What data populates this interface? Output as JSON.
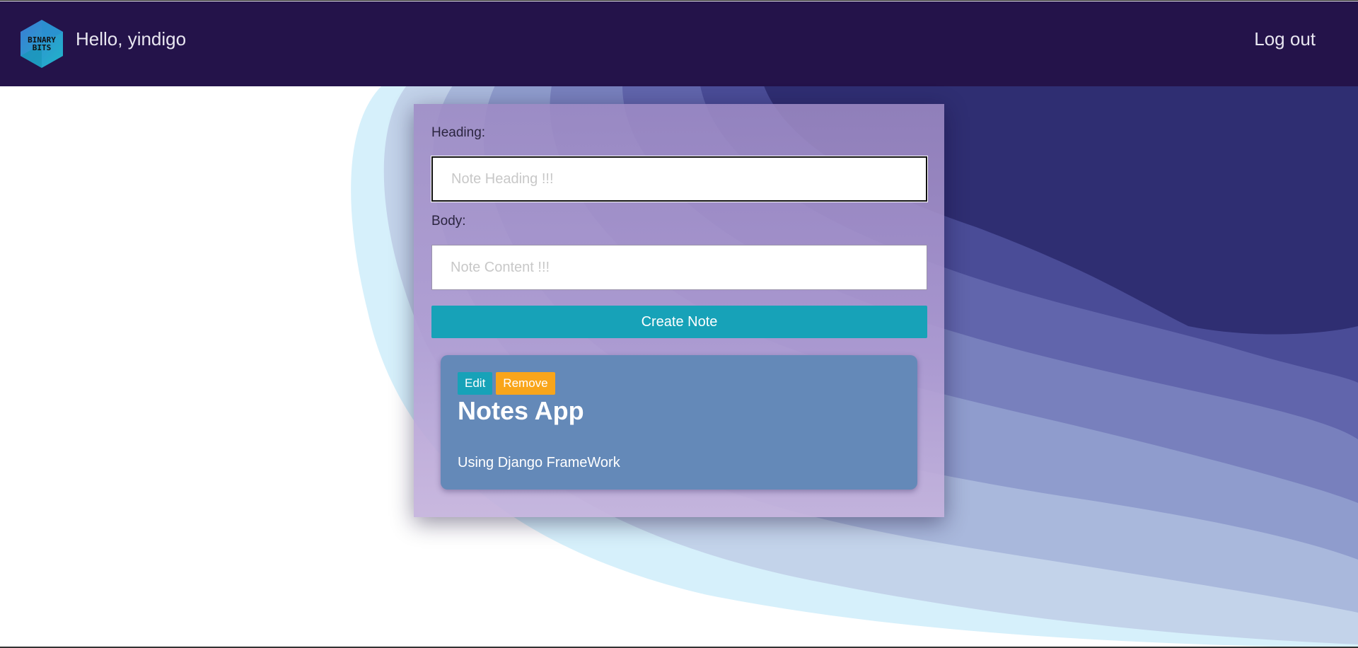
{
  "header": {
    "logo_text_line1": "BINARY",
    "logo_text_line2": "BITS",
    "greeting": "Hello, yindigo",
    "logout_label": "Log out"
  },
  "form": {
    "heading_label": "Heading:",
    "heading_placeholder": "Note Heading !!!",
    "heading_value": "",
    "body_label": "Body:",
    "body_placeholder": "Note Content !!!",
    "body_value": "",
    "submit_label": "Create Note"
  },
  "notes": [
    {
      "edit_label": "Edit",
      "remove_label": "Remove",
      "title": "Notes App",
      "body": "Using Django FrameWork"
    }
  ],
  "colors": {
    "navbar": "#24134a",
    "primary_button": "#17a2b8",
    "warning_button": "#f9a51a",
    "note_card": "#6489b8"
  }
}
